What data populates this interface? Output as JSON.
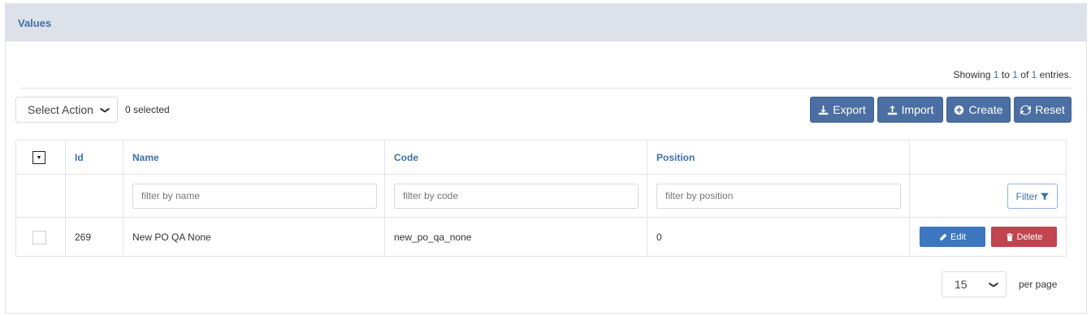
{
  "panel": {
    "title": "Values"
  },
  "info": {
    "prefix": "Showing ",
    "from": "1",
    "to_word": " to ",
    "to": "1",
    "of_word": " of ",
    "total": "1",
    "suffix": " entries."
  },
  "toolbar": {
    "select_action": "Select Action",
    "selected_count": "0 selected",
    "export_label": "Export",
    "import_label": "Import",
    "create_label": "Create",
    "reset_label": "Reset"
  },
  "table": {
    "columns": [
      "Id",
      "Name",
      "Code",
      "Position"
    ],
    "filters": {
      "name_placeholder": "filter by name",
      "code_placeholder": "filter by code",
      "position_placeholder": "filter by position",
      "filter_button": "Filter"
    },
    "rows": [
      {
        "id": "269",
        "name": "New PO QA None",
        "code": "new_po_qa_none",
        "position": "0",
        "edit_label": "Edit",
        "delete_label": "Delete"
      }
    ]
  },
  "pagination": {
    "per_page_value": "15",
    "per_page_label": "per page"
  },
  "colors": {
    "primary": "#4c6fa3",
    "danger": "#c0454f",
    "header_bg": "#dde2ea",
    "link": "#3f6fa8"
  }
}
